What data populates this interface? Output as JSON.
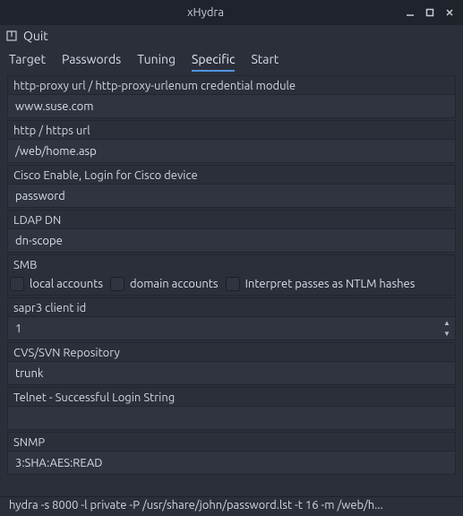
{
  "window": {
    "title": "xHydra"
  },
  "menu": {
    "quit": "Quit"
  },
  "tabs": [
    {
      "id": "target",
      "label": "Target"
    },
    {
      "id": "passwords",
      "label": "Passwords"
    },
    {
      "id": "tuning",
      "label": "Tuning"
    },
    {
      "id": "specific",
      "label": "Specific"
    },
    {
      "id": "start",
      "label": "Start"
    }
  ],
  "active_tab": "specific",
  "form": {
    "http_proxy": {
      "label": "http-proxy url / http-proxy-urlenum credential module",
      "value": "www.suse.com"
    },
    "http_url": {
      "label": "http / https url",
      "value": "/web/home.asp"
    },
    "cisco": {
      "label": "Cisco Enable, Login for Cisco device",
      "value": "password"
    },
    "ldap": {
      "label": "LDAP DN",
      "value": "dn-scope"
    },
    "smb": {
      "label": "SMB",
      "options": [
        {
          "id": "local",
          "label": "local accounts",
          "checked": false
        },
        {
          "id": "domain",
          "label": "domain accounts",
          "checked": false
        },
        {
          "id": "ntlm",
          "label": "Interpret passes as NTLM hashes",
          "checked": false
        }
      ]
    },
    "sapr3": {
      "label": "sapr3 client id",
      "value": "1"
    },
    "cvssvn": {
      "label": "CVS/SVN Repository",
      "value": "trunk"
    },
    "telnet": {
      "label": "Telnet - Successful Login String",
      "value": ""
    },
    "snmp": {
      "label": "SNMP",
      "value": "3:SHA:AES:READ"
    }
  },
  "statusbar": "hydra -s 8000 -l private -P /usr/share/john/password.lst -t 16 -m /web/h..."
}
